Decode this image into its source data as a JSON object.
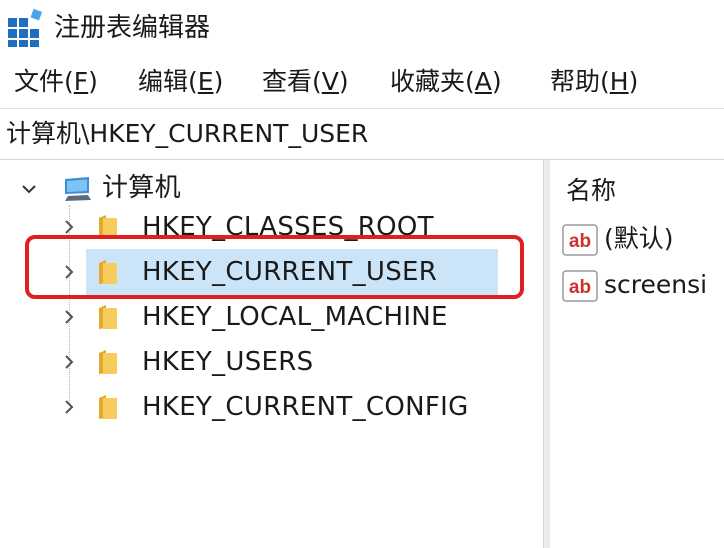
{
  "window": {
    "title": "注册表编辑器"
  },
  "menu": {
    "items": [
      {
        "label_pre": "文件(",
        "key": "F",
        "label_post": ")"
      },
      {
        "label_pre": "编辑(",
        "key": "E",
        "label_post": ")"
      },
      {
        "label_pre": "查看(",
        "key": "V",
        "label_post": ")"
      },
      {
        "label_pre": "收藏夹(",
        "key": "A",
        "label_post": ")"
      },
      {
        "label_pre": "帮助(",
        "key": "H",
        "label_post": ")"
      }
    ]
  },
  "address": {
    "path": "计算机\\HKEY_CURRENT_USER"
  },
  "tree": {
    "root": {
      "label": "计算机",
      "icon": "computer-icon",
      "expanded": true
    },
    "keys": [
      {
        "label": "HKEY_CLASSES_ROOT",
        "icon": "folder-icon"
      },
      {
        "label": "HKEY_CURRENT_USER",
        "icon": "folder-icon",
        "selected": true
      },
      {
        "label": "HKEY_LOCAL_MACHINE",
        "icon": "folder-icon"
      },
      {
        "label": "HKEY_USERS",
        "icon": "folder-icon"
      },
      {
        "label": "HKEY_CURRENT_CONFIG",
        "icon": "folder-icon"
      }
    ]
  },
  "values_pane": {
    "column_name": "名称",
    "rows": [
      {
        "label": "(默认)",
        "icon": "string-value-icon"
      },
      {
        "label": "screensi",
        "icon": "string-value-icon"
      }
    ]
  },
  "colors": {
    "selection": "#cce4f7",
    "annotation_box": "#e02020",
    "folder": "#f2c14e"
  }
}
